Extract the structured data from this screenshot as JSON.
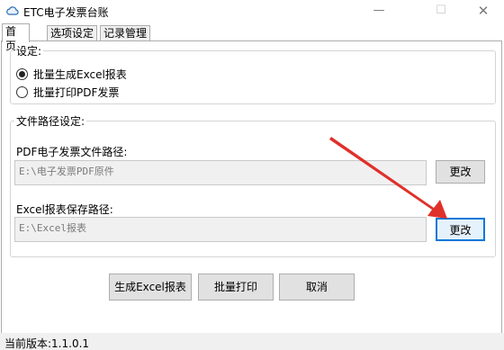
{
  "window": {
    "title": "ETC电子发票台账",
    "minimize_glyph": "—",
    "maximize_glyph": "☐",
    "close_glyph": "✕"
  },
  "tabs": [
    {
      "label": "首页",
      "active": true
    },
    {
      "label": "选项设定",
      "active": false
    },
    {
      "label": "记录管理",
      "active": false
    }
  ],
  "settings": {
    "legend": "设定:",
    "options": [
      {
        "label": "批量生成Excel报表",
        "checked": true
      },
      {
        "label": "批量打印PDF发票",
        "checked": false
      }
    ]
  },
  "paths": {
    "legend": "文件路径设定:",
    "pdf_label": "PDF电子发票文件路径:",
    "pdf_value": "E:\\电子发票PDF原件",
    "excel_label": "Excel报表保存路径:",
    "excel_value": "E:\\Excel报表",
    "change_label": "更改"
  },
  "actions": {
    "generate_label": "生成Excel报表",
    "print_label": "批量打印",
    "cancel_label": "取消"
  },
  "status": {
    "version_text": "当前版本:1.1.0.1"
  },
  "colors": {
    "annotation_arrow": "#e0302a",
    "focus_border": "#0078d7"
  },
  "icons": {
    "app_icon": "cloud-icon"
  }
}
